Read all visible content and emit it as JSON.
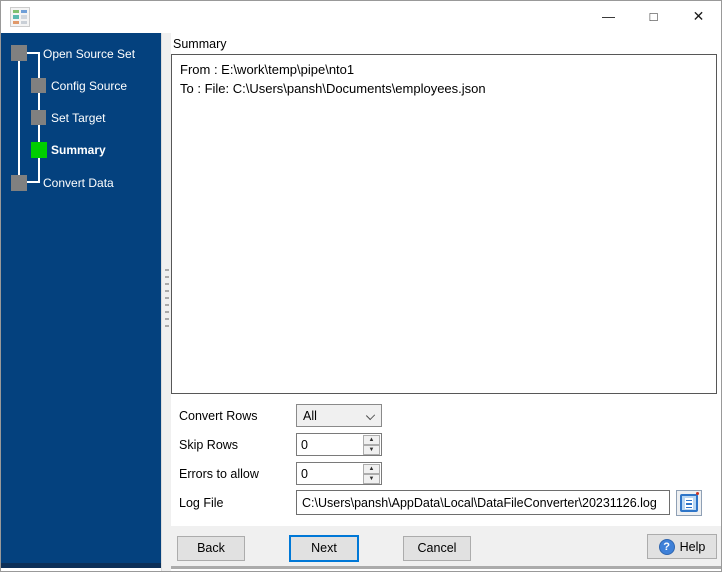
{
  "titlebar": {
    "icons": {
      "minimize": "—",
      "maximize": "□",
      "close": "✕"
    }
  },
  "sidebar": {
    "steps": [
      {
        "label": "Open Source Set",
        "state": "done"
      },
      {
        "label": "Config Source",
        "state": "pending"
      },
      {
        "label": "Set Target",
        "state": "pending"
      },
      {
        "label": "Summary",
        "state": "active"
      },
      {
        "label": "Convert Data",
        "state": "pending"
      }
    ]
  },
  "summary": {
    "title": "Summary",
    "lines": [
      "From : E:\\work\\temp\\pipe\\nto1",
      "To : File: C:\\Users\\pansh\\Documents\\employees.json"
    ]
  },
  "form": {
    "convert_rows_label": "Convert Rows",
    "convert_rows_value": "All",
    "skip_rows_label": "Skip Rows",
    "skip_rows_value": "0",
    "errors_label": "Errors to allow",
    "errors_value": "0",
    "log_label": "Log File",
    "log_value": "C:\\Users\\pansh\\AppData\\Local\\DataFileConverter\\20231126.log"
  },
  "buttons": {
    "back": "Back",
    "next": "Next",
    "cancel": "Cancel",
    "help": "Help"
  },
  "icons": {
    "spin_up": "▲",
    "spin_down": "▼",
    "help_glyph": "?"
  },
  "colors": {
    "sidebar_bg": "#04417E",
    "active_step_green": "#00CE00",
    "step_gray": "#808080",
    "accent_blue": "#0078D7",
    "panel_gray": "#f0f0f0"
  }
}
